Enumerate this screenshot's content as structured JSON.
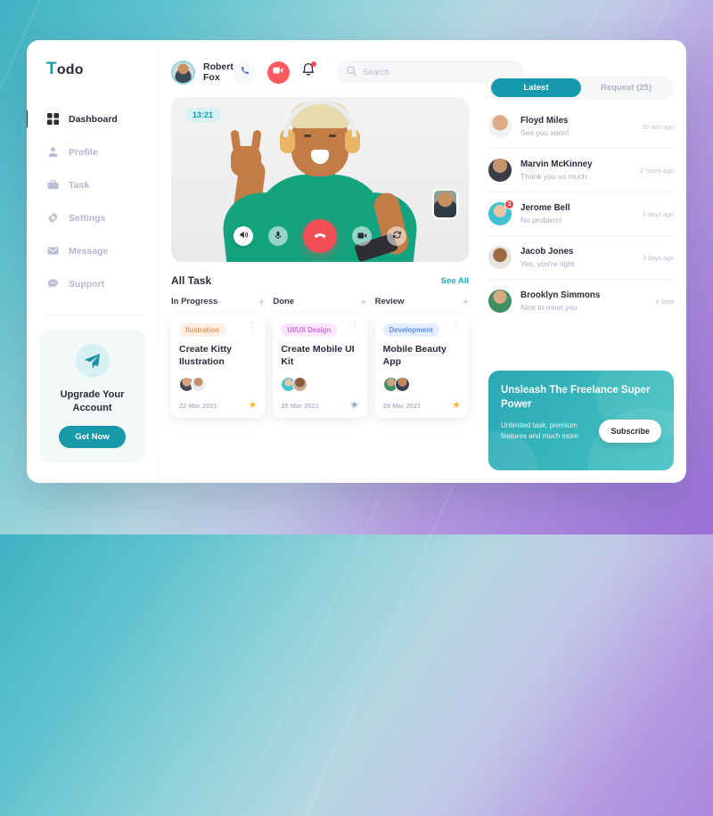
{
  "background": {
    "gradient_from": "#3fb3c4",
    "gradient_to": "#9b6fd6"
  },
  "brand": {
    "logo_first": "T",
    "logo_rest": "odo",
    "accent": "#169aab"
  },
  "sidebar": {
    "items": [
      {
        "label": "Dashboard",
        "icon": "grid-icon",
        "active": true
      },
      {
        "label": "Profile",
        "icon": "user-icon",
        "active": false
      },
      {
        "label": "Task",
        "icon": "briefcase-icon",
        "active": false
      },
      {
        "label": "Settings",
        "icon": "gear-icon",
        "active": false
      },
      {
        "label": "Message",
        "icon": "mail-icon",
        "active": false
      },
      {
        "label": "Support",
        "icon": "chat-icon",
        "active": false
      }
    ],
    "upgrade": {
      "icon": "paper-plane-icon",
      "title": "Upgrade Your Account",
      "button": "Get Now"
    }
  },
  "topbar": {
    "user_name": "Robert Fox",
    "avatar": "user-avatar",
    "phone_icon": "phone-icon",
    "video_icon": "video-camera-icon",
    "bell_icon": "bell-icon",
    "search": {
      "placeholder": "Search",
      "value": "",
      "icon": "search-icon"
    }
  },
  "video_call": {
    "timer": "13:21",
    "controls": [
      {
        "name": "speaker-button",
        "icon": "speaker-icon"
      },
      {
        "name": "microphone-button",
        "icon": "microphone-icon"
      },
      {
        "name": "end-call-button",
        "icon": "phone-hangup-icon"
      },
      {
        "name": "camera-button",
        "icon": "video-camera-icon"
      },
      {
        "name": "switch-camera-button",
        "icon": "refresh-icon"
      }
    ],
    "pip_label": "self-view"
  },
  "tasks": {
    "section_title": "All Task",
    "see_all": "See All",
    "columns": [
      {
        "label": "In Progress",
        "add": "+"
      },
      {
        "label": "Done",
        "add": "+"
      },
      {
        "label": "Review",
        "add": "+"
      }
    ],
    "cards": [
      {
        "tag": "Ilustration",
        "tag_color": "#e8a472",
        "tag_bg": "#fdeee1",
        "title": "Create Kitty Ilustration",
        "date": "22 Mar 2021",
        "star": "★",
        "star_color": "#f7b731",
        "members": [
          "#d8a383",
          "#8f7a63"
        ]
      },
      {
        "tag": "UI/UX Design",
        "tag_color": "#c96ad6",
        "tag_bg": "#fbe6fb",
        "title": "Create Mobile UI Kit",
        "date": "25 Mar 2021",
        "star": "★",
        "star_color": "#8ba4d4",
        "members": [
          "#4fc2d2",
          "#6e4b35"
        ]
      },
      {
        "tag": "Development",
        "tag_color": "#5b8ff0",
        "tag_bg": "#e4edfd",
        "title": "Mobile Beauty App",
        "date": "29 Mar 2021",
        "star": "★",
        "star_color": "#f7b731",
        "members": [
          "#3f8f63",
          "#c4885f"
        ]
      }
    ]
  },
  "messages": {
    "tabs": [
      {
        "label": "Latest",
        "active": true
      },
      {
        "label": "Request (25)",
        "active": false
      }
    ],
    "items": [
      {
        "name": "Floyd Miles",
        "preview": "See you soon!",
        "time": "20 min ago",
        "badge": "",
        "avatar_color": "#d9a183"
      },
      {
        "name": "Marvin McKinney",
        "preview": "Thank you so much",
        "time": "2 hours ago",
        "badge": "",
        "avatar_color": "#8c7a68"
      },
      {
        "name": "Jerome Bell",
        "preview": "No problem!",
        "time": "2 days ago",
        "badge": "3",
        "avatar_color": "#3fc1cf"
      },
      {
        "name": "Jacob Jones",
        "preview": "Yes, you're right",
        "time": "3 days ago",
        "badge": "",
        "avatar_color": "#6b4a33"
      },
      {
        "name": "Brooklyn Simmons",
        "preview": "Nice to meet you",
        "time": "4 Sept",
        "badge": "",
        "avatar_color": "#3f8f63"
      }
    ]
  },
  "promo": {
    "title": "Unsleash The Freelance Super Power",
    "subtitle": "Unlimited task, premium features and much more",
    "button": "Subscribe"
  }
}
